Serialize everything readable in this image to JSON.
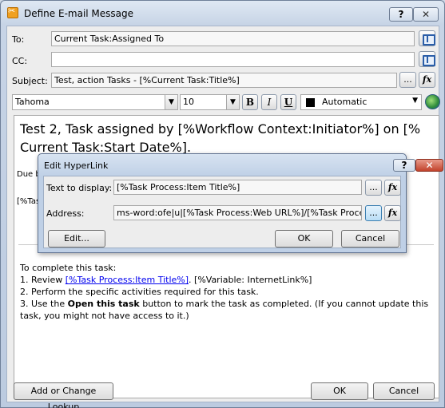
{
  "window": {
    "title": "Define E-mail Message"
  },
  "form": {
    "to_label": "To:",
    "to_value": "Current Task:Assigned To",
    "cc_label": "CC:",
    "cc_value": "",
    "subject_label": "Subject:",
    "subject_value": "Test, action Tasks - [%Current Task:Title%]"
  },
  "toolbar": {
    "font": "Tahoma",
    "size": "10",
    "bold": "B",
    "italic": "I",
    "underline": "U",
    "color_label": "Automatic",
    "color_value": "#000000",
    "ellipsis": "...",
    "fx": "fx"
  },
  "editor": {
    "heading": "Test 2, Task assigned by [%Workflow Context:Initiator%] on [% Current Task:Start Date%].",
    "due_prefix": "Due b",
    "tas_prefix": "[%Tas",
    "intro": "To complete this task:",
    "step1_prefix": "1. Review ",
    "step1_link": "[%Task Process:Item Title%]",
    "step1_suffix": ". [%Variable: InternetLink%]",
    "step2": "2. Perform the specific activities required for this task.",
    "step3_prefix": "3. Use the ",
    "step3_bold": "Open this task",
    "step3_suffix": " button to mark the task as completed. (If you cannot update this task, you might not have access to it.)"
  },
  "footer": {
    "lookup_button": "Add or Change Lookup",
    "ok_button": "OK",
    "cancel_button": "Cancel"
  },
  "dialog": {
    "title": "Edit HyperLink",
    "help": "?",
    "close": "✕",
    "text_label": "Text to display:",
    "text_value": "[%Task Process:Item Title%]",
    "address_label": "Address:",
    "address_value": "ms-word:ofe|u|[%Task Process:Web URL%]/[%Task Process:It",
    "edit_button": "Edit...",
    "ok_button": "OK",
    "cancel_button": "Cancel"
  },
  "colors": {
    "link": "#0000ee",
    "accent": "#2b5ea8"
  }
}
